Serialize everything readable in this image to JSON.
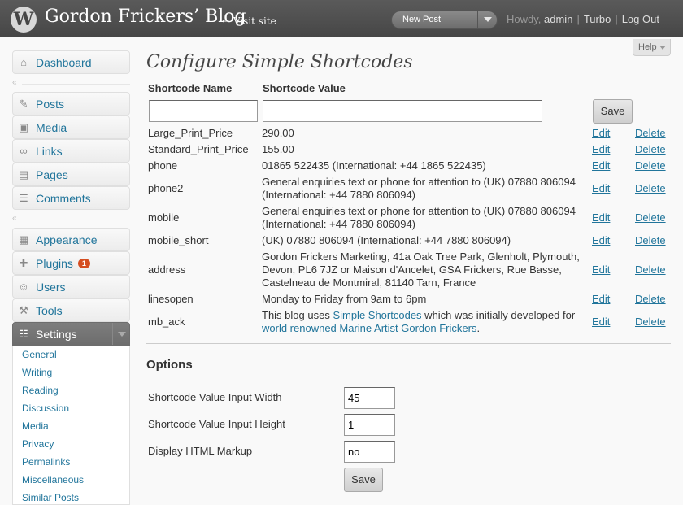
{
  "header": {
    "site_title": "Gordon Frickers’ Blog",
    "visit_site": "← Visit site",
    "new_post": "New Post",
    "howdy": "Howdy,",
    "user": "admin",
    "turbo": "Turbo",
    "logout": "Log Out",
    "help": "Help"
  },
  "sidebar": {
    "items": [
      {
        "label": "Dashboard",
        "icon": "dashboard-icon",
        "glyph": "⌂"
      },
      {
        "label": "Posts",
        "icon": "pushpin-icon",
        "glyph": "✎"
      },
      {
        "label": "Media",
        "icon": "media-icon",
        "glyph": "▣"
      },
      {
        "label": "Links",
        "icon": "link-icon",
        "glyph": "∞"
      },
      {
        "label": "Pages",
        "icon": "page-icon",
        "glyph": "▤"
      },
      {
        "label": "Comments",
        "icon": "comment-icon",
        "glyph": "☰"
      },
      {
        "label": "Appearance",
        "icon": "appearance-icon",
        "glyph": "▦"
      },
      {
        "label": "Plugins",
        "icon": "plugin-icon",
        "glyph": "✚",
        "badge": "1"
      },
      {
        "label": "Users",
        "icon": "users-icon",
        "glyph": "☺"
      },
      {
        "label": "Tools",
        "icon": "tools-icon",
        "glyph": "⚒"
      },
      {
        "label": "Settings",
        "icon": "settings-icon",
        "glyph": "☷"
      }
    ],
    "submenu": [
      "General",
      "Writing",
      "Reading",
      "Discussion",
      "Media",
      "Privacy",
      "Permalinks",
      "Miscellaneous",
      "Similar Posts"
    ]
  },
  "main": {
    "title": "Configure Simple Shortcodes",
    "col_name": "Shortcode Name",
    "col_value": "Shortcode Value",
    "save": "Save",
    "edit": "Edit",
    "delete": "Delete",
    "rows": [
      {
        "name": "Large_Print_Price",
        "value": "290.00"
      },
      {
        "name": "Standard_Print_Price",
        "value": "155.00"
      },
      {
        "name": "phone",
        "value": "01865 522435 (International: +44 1865 522435)"
      },
      {
        "name": "phone2",
        "value": "General enquiries text or phone for attention to (UK) 07880 806094 (International: +44 7880 806094)"
      },
      {
        "name": "mobile",
        "value": "General enquiries text or phone for attention to (UK) 07880 806094 (International: +44 7880 806094)"
      },
      {
        "name": "mobile_short",
        "value": "(UK) 07880 806094 (International: +44 7880 806094)"
      },
      {
        "name": "address",
        "value": "Gordon Frickers Marketing, 41a Oak Tree Park, Glenholt, Plymouth, Devon, PL6 7JZ or Maison d'Ancelet, GSA Frickers, Rue Basse, Castelneau de Montmiral, 81140 Tarn, France"
      },
      {
        "name": "linesopen",
        "value": "Monday to Friday from 9am to 6pm"
      }
    ],
    "mb_ack": {
      "name": "mb_ack",
      "pre": "This blog uses ",
      "link1": "Simple Shortcodes",
      "mid": " which was initially developed for ",
      "link2": "world renowned Marine Artist Gordon Frickers",
      "post": "."
    }
  },
  "options": {
    "title": "Options",
    "width_label": "Shortcode Value Input Width",
    "width_value": "45",
    "height_label": "Shortcode Value Input Height",
    "height_value": "1",
    "html_label": "Display HTML Markup",
    "html_value": "no",
    "save": "Save"
  }
}
